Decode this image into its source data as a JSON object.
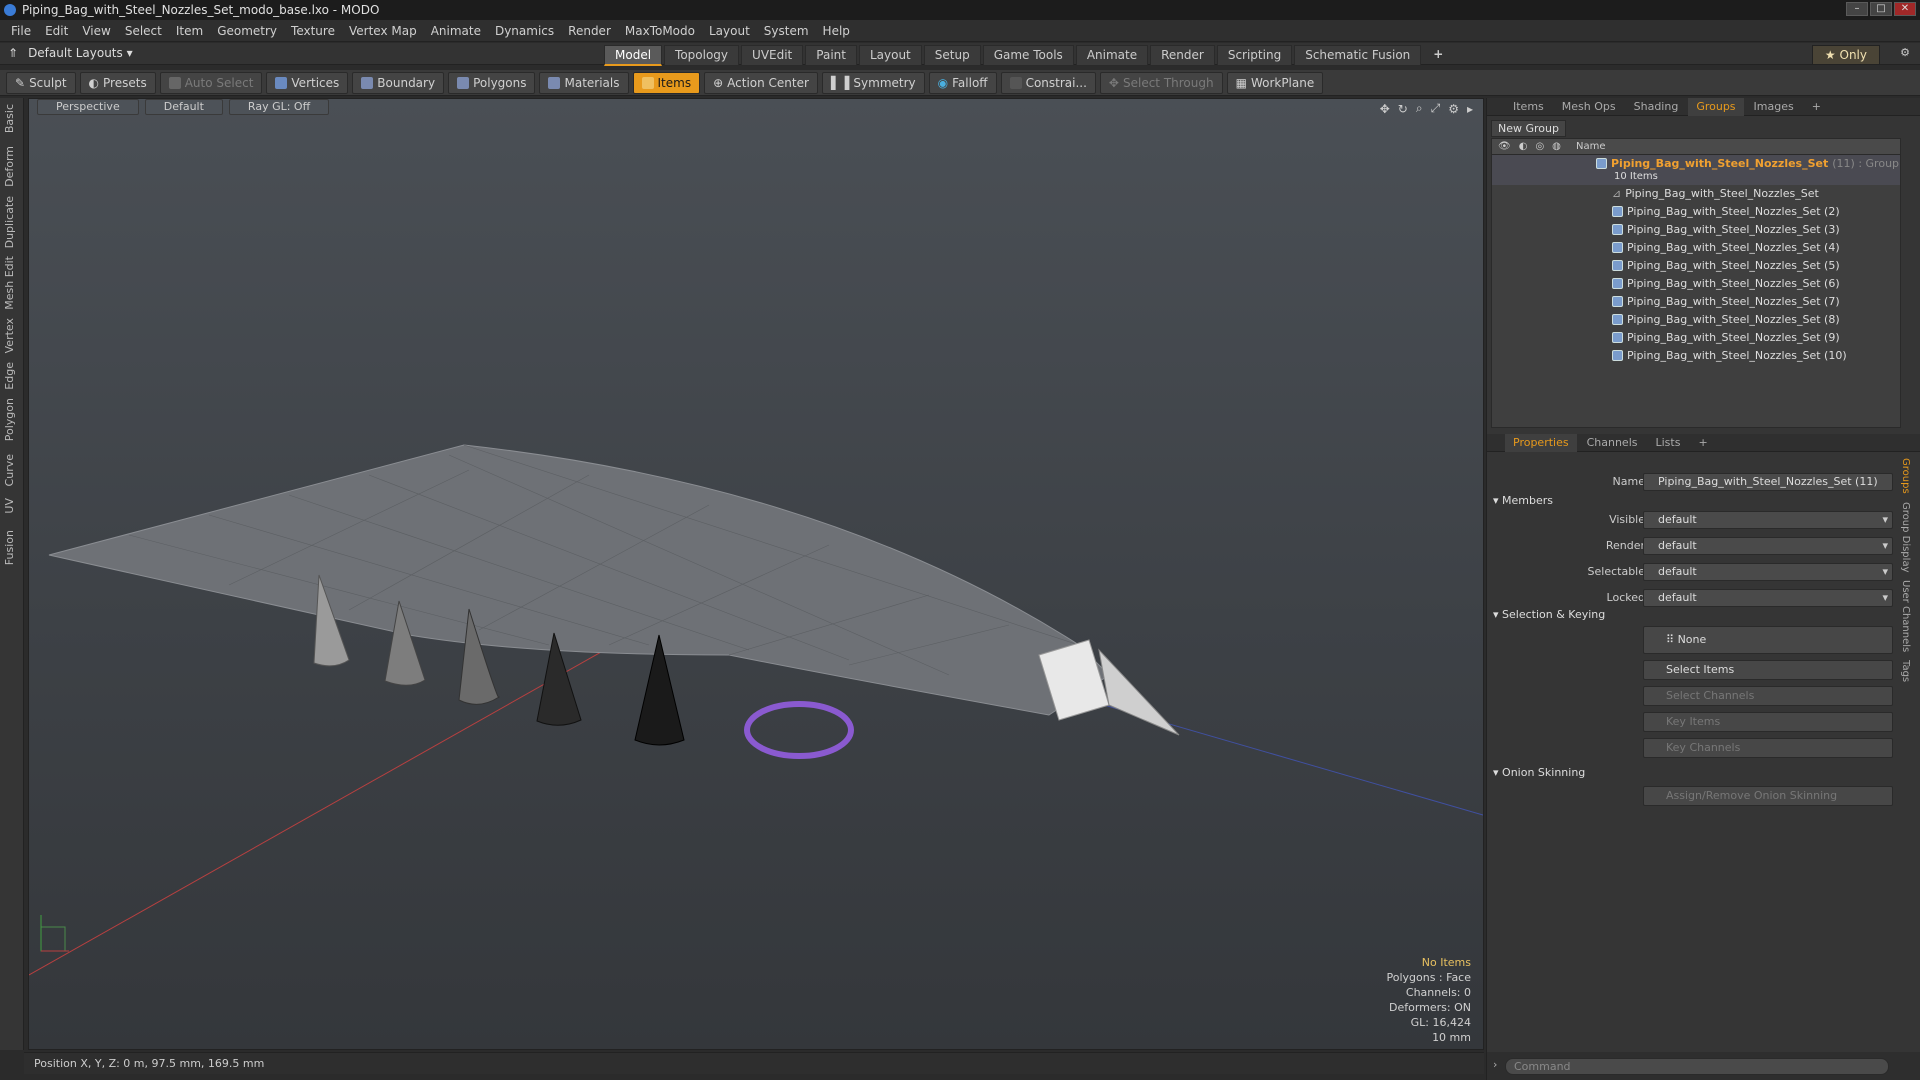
{
  "window": {
    "title": "Piping_Bag_with_Steel_Nozzles_Set_modo_base.lxo - MODO"
  },
  "menu": [
    "File",
    "Edit",
    "View",
    "Select",
    "Item",
    "Geometry",
    "Texture",
    "Vertex Map",
    "Animate",
    "Dynamics",
    "Render",
    "MaxToModo",
    "Layout",
    "System",
    "Help"
  ],
  "layout_bar": {
    "layouts": "Default Layouts",
    "tabs": [
      "Model",
      "Topology",
      "UVEdit",
      "Paint",
      "Layout",
      "Setup",
      "Game Tools",
      "Animate",
      "Render",
      "Scripting",
      "Schematic Fusion"
    ],
    "only": "Only"
  },
  "toolbar": {
    "sculpt": "Sculpt",
    "presets": "Presets",
    "auto_select": "Auto Select",
    "vertices": "Vertices",
    "boundary": "Boundary",
    "polygons": "Polygons",
    "materials": "Materials",
    "items": "Items",
    "action_center": "Action Center",
    "symmetry": "Symmetry",
    "falloff": "Falloff",
    "constraints": "Constrai...",
    "select_through": "Select Through",
    "workplane": "WorkPlane"
  },
  "left_tabs": [
    "Basic",
    "Deform",
    "Duplicate",
    "Mesh Edit",
    "Vertex",
    "Edge",
    "Polygon",
    "Curve",
    "UV",
    "Fusion"
  ],
  "viewport": {
    "view": "Perspective",
    "shading": "Default",
    "raygl": "Ray GL: Off",
    "info": {
      "selection": "No Items",
      "polygons": "Polygons : Face",
      "channels": "Channels: 0",
      "deformers": "Deformers: ON",
      "gl": "GL: 16,424",
      "scale": "10 mm"
    }
  },
  "status": {
    "position": "Position X, Y, Z:  0 m, 97.5 mm, 169.5 mm"
  },
  "panel_tabs": [
    "Items",
    "Mesh Ops",
    "Shading",
    "Groups",
    "Images"
  ],
  "groups": {
    "new_group": "New Group",
    "name_col": "Name",
    "root": {
      "name": "Piping_Bag_with_Steel_Nozzles_Set",
      "count": "(11) : Group",
      "items": "10 Items"
    },
    "children": [
      "Piping_Bag_with_Steel_Nozzles_Set",
      "Piping_Bag_with_Steel_Nozzles_Set (2)",
      "Piping_Bag_with_Steel_Nozzles_Set (3)",
      "Piping_Bag_with_Steel_Nozzles_Set (4)",
      "Piping_Bag_with_Steel_Nozzles_Set (5)",
      "Piping_Bag_with_Steel_Nozzles_Set (6)",
      "Piping_Bag_with_Steel_Nozzles_Set (7)",
      "Piping_Bag_with_Steel_Nozzles_Set (8)",
      "Piping_Bag_with_Steel_Nozzles_Set (9)",
      "Piping_Bag_with_Steel_Nozzles_Set (10)"
    ]
  },
  "prop_tabs": [
    "Properties",
    "Channels",
    "Lists"
  ],
  "properties": {
    "name_label": "Name",
    "name_value": "Piping_Bag_with_Steel_Nozzles_Set (11)",
    "members": "Members",
    "visible_label": "Visible",
    "visible_value": "default",
    "render_label": "Render",
    "render_value": "default",
    "selectable_label": "Selectable",
    "selectable_value": "default",
    "locked_label": "Locked",
    "locked_value": "default",
    "sel_keying": "Selection & Keying",
    "none": "None",
    "select_items": "Select Items",
    "select_channels": "Select Channels",
    "key_items": "Key Items",
    "key_channels": "Key Channels",
    "onion": "Onion Skinning",
    "assign_onion": "Assign/Remove Onion Skinning"
  },
  "right_vtabs": [
    "Groups",
    "Group Display",
    "User Channels",
    "Tags"
  ],
  "command": {
    "placeholder": "Command"
  }
}
